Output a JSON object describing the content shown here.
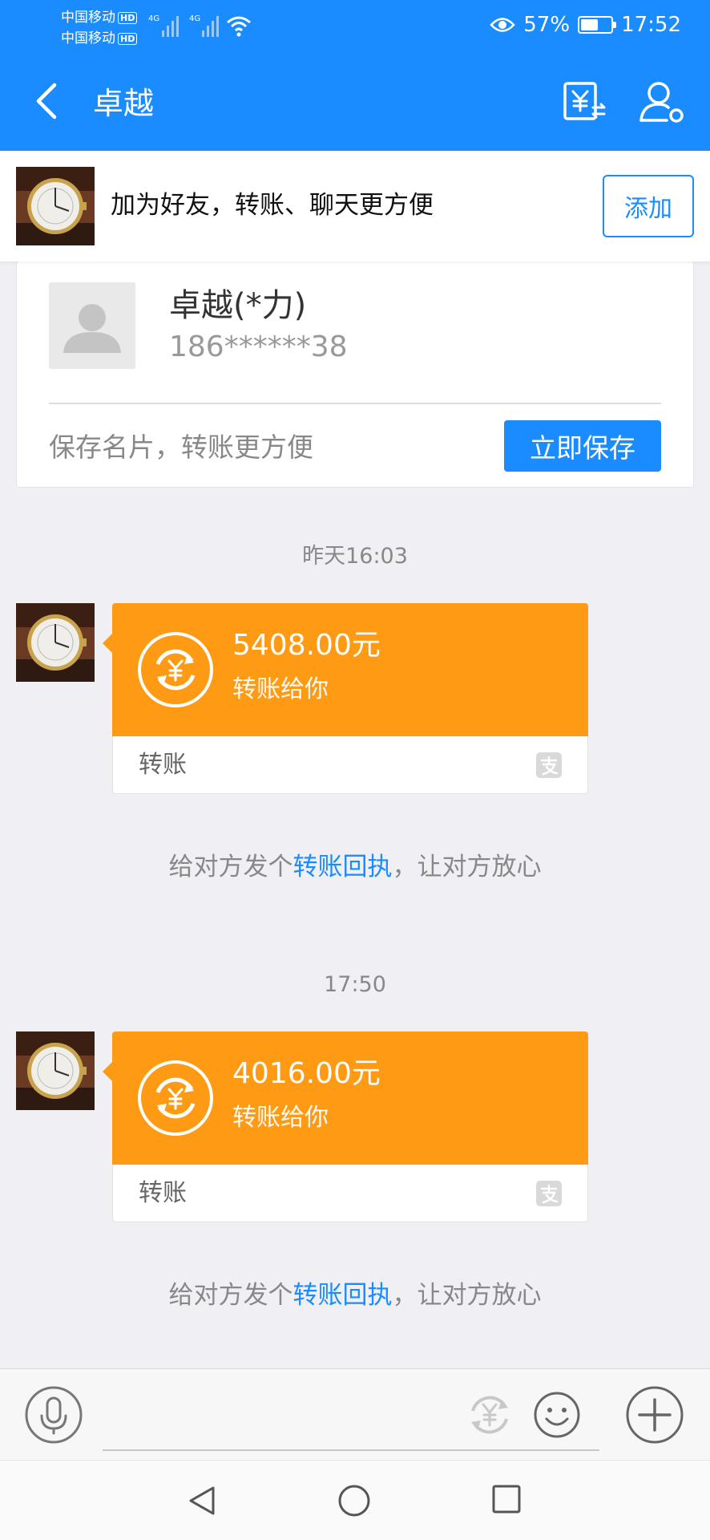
{
  "status_bar": {
    "carrier1": "中国移动",
    "carrier2": "中国移动",
    "hd_badge": "HD",
    "network1": "4G",
    "network2": "4G",
    "battery": "57%",
    "battery_level": 0.57,
    "time": "17:52",
    "icons": [
      "eye-icon",
      "wifi-icon",
      "battery-icon"
    ]
  },
  "header": {
    "title": "卓越",
    "back_icon": "chevron-left-icon",
    "transfer_icon": "yuan-transfer-icon",
    "contact_icon": "person-settings-icon"
  },
  "friend_bar": {
    "text": "加为好友，转账、聊天更方便",
    "add_label": "添加"
  },
  "card": {
    "name": "卓越(*力)",
    "phone": "186******38",
    "hint": "保存名片，转账更方便",
    "save_label": "立即保存"
  },
  "messages": [
    {
      "timestamp": "昨天16:03",
      "amount": "5408.00元",
      "subtitle": "转账给你",
      "label": "转账"
    },
    {
      "timestamp": "17:50",
      "amount": "4016.00元",
      "subtitle": "转账给你",
      "label": "转账"
    }
  ],
  "receipt": {
    "prefix": "给对方发个",
    "link": "转账回执",
    "suffix": "，让对方放心"
  },
  "input_bar": {
    "placeholder": "",
    "icons": [
      "microphone-icon",
      "yuan-pay-icon",
      "smiley-icon",
      "plus-icon"
    ]
  },
  "nav_bar": {
    "icons": [
      "nav-back-icon",
      "nav-home-icon",
      "nav-recent-icon"
    ]
  },
  "colors": {
    "primary": "#1a8cff",
    "transfer_orange": "#ff9a14",
    "background": "#efeff4"
  }
}
